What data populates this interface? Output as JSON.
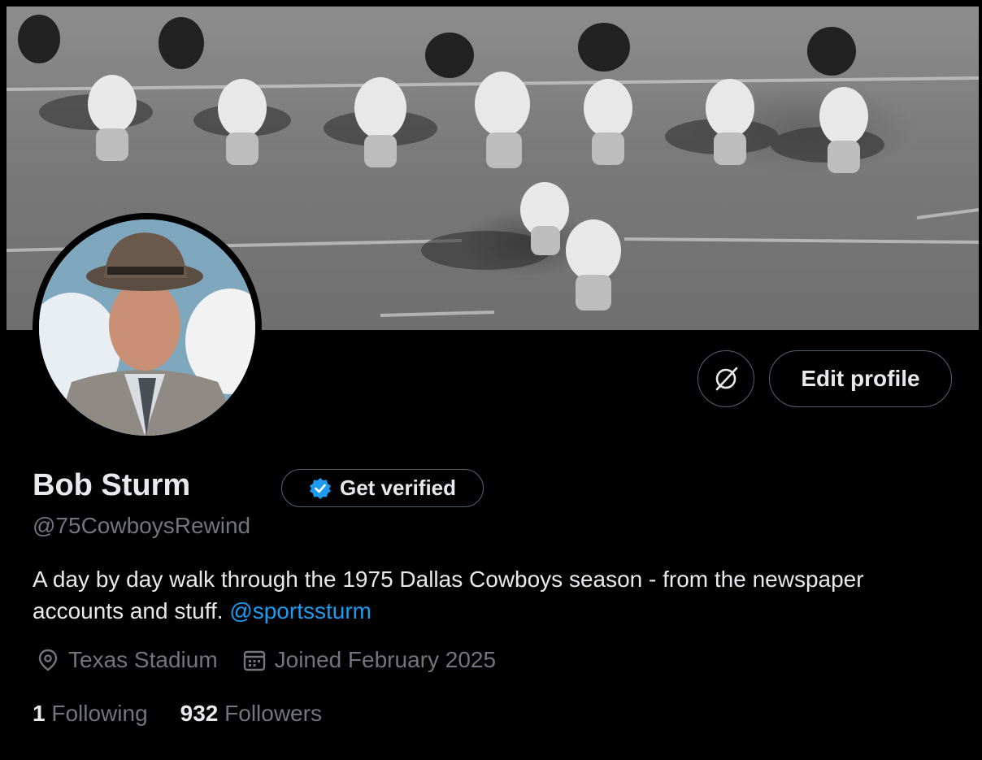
{
  "profile": {
    "name": "Bob Sturm",
    "handle": "@75CowboysRewind",
    "bio_text": "A day by day walk through the 1975 Dallas Cowboys season - from the newspaper accounts and stuff.",
    "bio_link": "@sportssturm",
    "location": "Texas Stadium",
    "joined": "Joined February 2025",
    "following_count": "1",
    "following_label": "Following",
    "followers_count": "932",
    "followers_label": "Followers"
  },
  "buttons": {
    "edit_profile": "Edit profile",
    "get_verified": "Get verified"
  },
  "icons": {
    "grok": "slash-circle-icon",
    "verified": "verified-badge-icon",
    "location": "location-pin-icon",
    "calendar": "calendar-icon"
  },
  "colors": {
    "background": "#000000",
    "text": "#e7e9ea",
    "secondary": "#71767b",
    "link": "#1d9bf0",
    "border": "#536471"
  }
}
